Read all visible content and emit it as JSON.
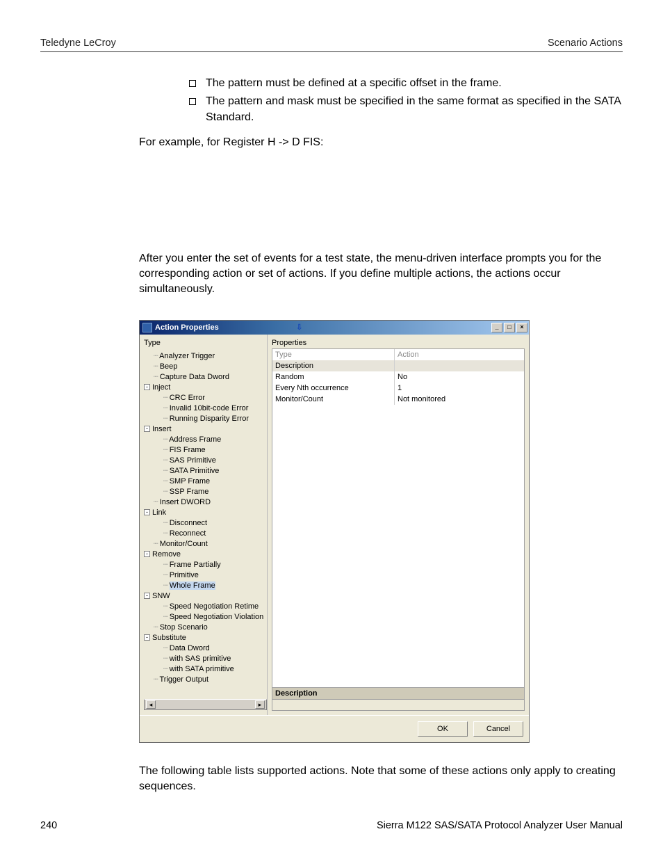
{
  "header": {
    "left": "Teledyne LeCroy",
    "right": "Scenario Actions"
  },
  "bullets": [
    "The pattern must be defined at a specific offset in the frame.",
    "The pattern and mask must be specified in the same format as specified in the SATA Standard."
  ],
  "para_example": "For example, for Register H -> D FIS:",
  "para_after": "After you enter the set of events for a test state, the menu-driven interface prompts you for the corresponding action or set of actions. If you define multiple actions, the actions occur simultaneously.",
  "para_following": "The following table lists supported actions. Note that some of these actions only apply to creating sequences.",
  "footer": {
    "page": "240",
    "manual": "Sierra M122 SAS/SATA Protocol Analyzer User Manual"
  },
  "dialog": {
    "title": "Action Properties",
    "left_label": "Type",
    "right_label": "Properties",
    "desc_label": "Description",
    "ok": "OK",
    "cancel": "Cancel",
    "selected": "Whole Frame",
    "tree": {
      "n0": "Analyzer Trigger",
      "n1": "Beep",
      "n2": "Capture Data Dword",
      "g_inject": "Inject",
      "inject_0": "CRC Error",
      "inject_1": "Invalid 10bit-code Error",
      "inject_2": "Running Disparity Error",
      "g_insert": "Insert",
      "insert_0": "Address Frame",
      "insert_1": "FIS Frame",
      "insert_2": "SAS Primitive",
      "insert_3": "SATA Primitive",
      "insert_4": "SMP Frame",
      "insert_5": "SSP Frame",
      "n3": "Insert DWORD",
      "g_link": "Link",
      "link_0": "Disconnect",
      "link_1": "Reconnect",
      "n4": "Monitor/Count",
      "g_remove": "Remove",
      "remove_0": "Frame Partially",
      "remove_1": "Primitive",
      "remove_2": "Whole Frame",
      "g_snw": "SNW",
      "snw_0": "Speed Negotiation Retime",
      "snw_1": "Speed Negotiation Violation",
      "n5": "Stop Scenario",
      "g_sub": "Substitute",
      "sub_0": "Data Dword",
      "sub_1": "with SAS primitive",
      "sub_2": "with SATA primitive",
      "n6": "Trigger Output"
    },
    "props": {
      "r0k": "Type",
      "r0v": "Action",
      "r1k": "Description",
      "r1v": "",
      "r2k": "Random",
      "r2v": "No",
      "r3k": "Every Nth occurrence",
      "r3v": "1",
      "r4k": "Monitor/Count",
      "r4v": "Not monitored"
    }
  }
}
